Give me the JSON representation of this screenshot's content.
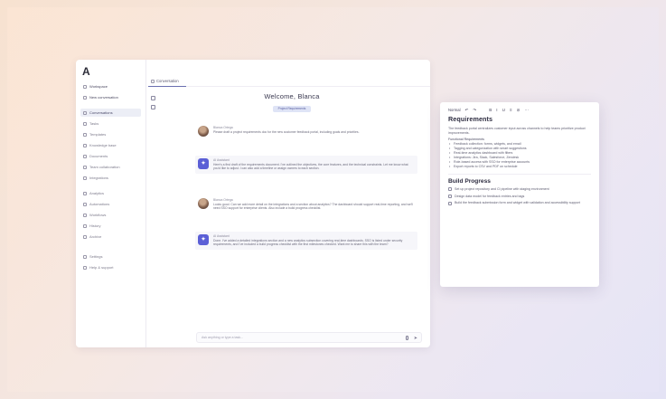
{
  "app": {
    "logo": "A",
    "tab_label": "Conversation"
  },
  "sidebar": {
    "items": [
      {
        "label": "Workspace",
        "active": false
      },
      {
        "label": "New conversation",
        "active": false
      },
      {
        "label": "Conversations",
        "active": true
      },
      {
        "label": "Tasks",
        "active": false
      },
      {
        "label": "Templates",
        "active": false
      },
      {
        "label": "Knowledge base",
        "active": false
      },
      {
        "label": "Documents",
        "active": false
      },
      {
        "label": "Team collaboration",
        "active": false
      },
      {
        "label": "Integrations",
        "active": false
      },
      {
        "label": "Analytics",
        "active": false
      },
      {
        "label": "Automations",
        "active": false
      },
      {
        "label": "Workflows",
        "active": false
      },
      {
        "label": "History",
        "active": false
      },
      {
        "label": "Archive",
        "active": false
      }
    ],
    "bottom_items": [
      {
        "label": "Settings"
      },
      {
        "label": "Help & support"
      }
    ]
  },
  "chat": {
    "title": "Welcome, Blanca",
    "chip": "Project Requirements",
    "messages": [
      {
        "author": "Blanca Ortega",
        "role": "user",
        "text": "Please draft a project requirements doc for the new customer feedback portal, including goals and priorities."
      },
      {
        "author": "AI Assistant",
        "role": "assistant",
        "text": "Here's a first draft of the requirements document. I've outlined the objectives, the core features, and the technical constraints. Let me know what you'd like to adjust. I can also add a timeline or assign owners to each section."
      },
      {
        "author": "Blanca Ortega",
        "role": "user",
        "text": "Looks good. Can we add more detail on the integrations and a section about analytics? The dashboard should support real-time reporting, and we'll need SSO support for enterprise clients. Also include a build progress checklist."
      },
      {
        "author": "AI Assistant",
        "role": "assistant",
        "text": "Done. I've added a detailed integrations section and a new analytics subsection covering real-time dashboards. SSO is listed under security requirements, and I've included a build progress checklist with the first milestones checked. Want me to share this with the team?"
      }
    ],
    "composer_placeholder": "Ask anything or type a task..."
  },
  "panel": {
    "toolbar": {
      "style_label": "Normal",
      "buttons": [
        "undo-icon",
        "redo-icon",
        "bold-icon",
        "italic-icon",
        "underline-icon",
        "list-icon",
        "link-icon",
        "more-icon"
      ]
    },
    "heading": "Requirements",
    "intro": "The feedback portal centralizes customer input across channels to help teams prioritize product improvements.",
    "list_title": "Functional Requirements",
    "requirements": [
      "Feedback collection: forms, widgets, and email",
      "Tagging and categorization with smart suggestions",
      "Real-time analytics dashboard with filters",
      "Integrations: Jira, Slack, Salesforce, Zendesk",
      "Role-based access with SSO for enterprise accounts",
      "Export reports to CSV and PDF on schedule"
    ],
    "progress_heading": "Build Progress",
    "checklist": [
      {
        "text": "Set up project repository and CI pipeline with staging environment",
        "checked": false
      },
      {
        "text": "Design data model for feedback entries and tags",
        "checked": false
      },
      {
        "text": "Build the feedback submission form and widget with validation and accessibility support",
        "checked": false
      }
    ]
  }
}
